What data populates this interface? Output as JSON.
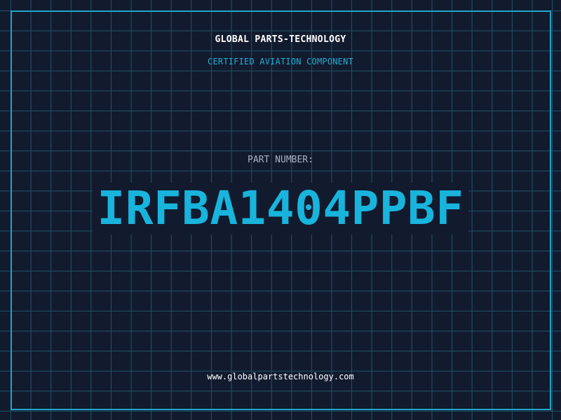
{
  "header": {
    "brand": "GLOBAL PARTS-TECHNOLOGY",
    "tagline": "CERTIFIED AVIATION COMPONENT"
  },
  "main": {
    "part_label": "PART NUMBER:",
    "part_number": "IRFBA1404PPBF"
  },
  "footer": {
    "website": "www.globalpartstechnology.com"
  },
  "colors": {
    "background": "#121a2e",
    "grid": "#1f5566",
    "accent": "#18b4dc",
    "text": "#ffffff",
    "muted": "#a9b2c3"
  }
}
